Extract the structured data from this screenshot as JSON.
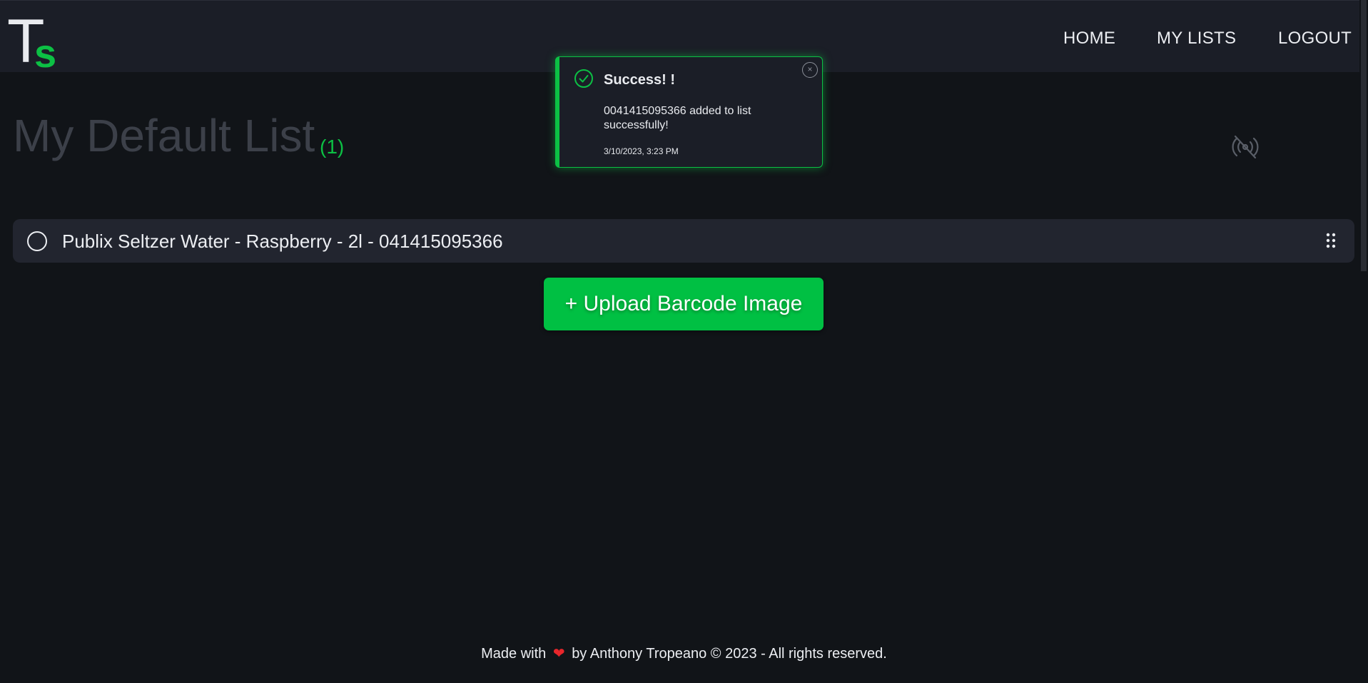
{
  "app": {
    "logo_main": "T",
    "logo_accent": "s"
  },
  "nav": {
    "home": "HOME",
    "my_lists": "MY LISTS",
    "logout": "LOGOUT"
  },
  "list": {
    "title": "My Default List",
    "count": "(1)",
    "items": [
      {
        "label": "Publix Seltzer Water - Raspberry - 2l - 041415095366",
        "checked": false
      }
    ]
  },
  "upload_button": {
    "label": "+ Upload Barcode Image"
  },
  "toast": {
    "title": "Success! !",
    "message": "0041415095366 added to list successfully!",
    "time": "3/10/2023, 3:23 PM",
    "close_symbol": "×"
  },
  "footer": {
    "before": "Made with",
    "heart": "❤",
    "after": "by Anthony Tropeano © 2023 - All rights reserved."
  },
  "icons": {
    "offline": "offline-broadcast-icon",
    "check": "check-circle-icon",
    "handle": "drag-handle-icon",
    "close": "close-icon",
    "heart": "heart-icon"
  },
  "colors": {
    "accent": "#0cc044",
    "background": "#111418",
    "navbar": "#1b1e27",
    "list_item": "#22252f",
    "title": "#3c4049",
    "heart": "#e8262b"
  }
}
